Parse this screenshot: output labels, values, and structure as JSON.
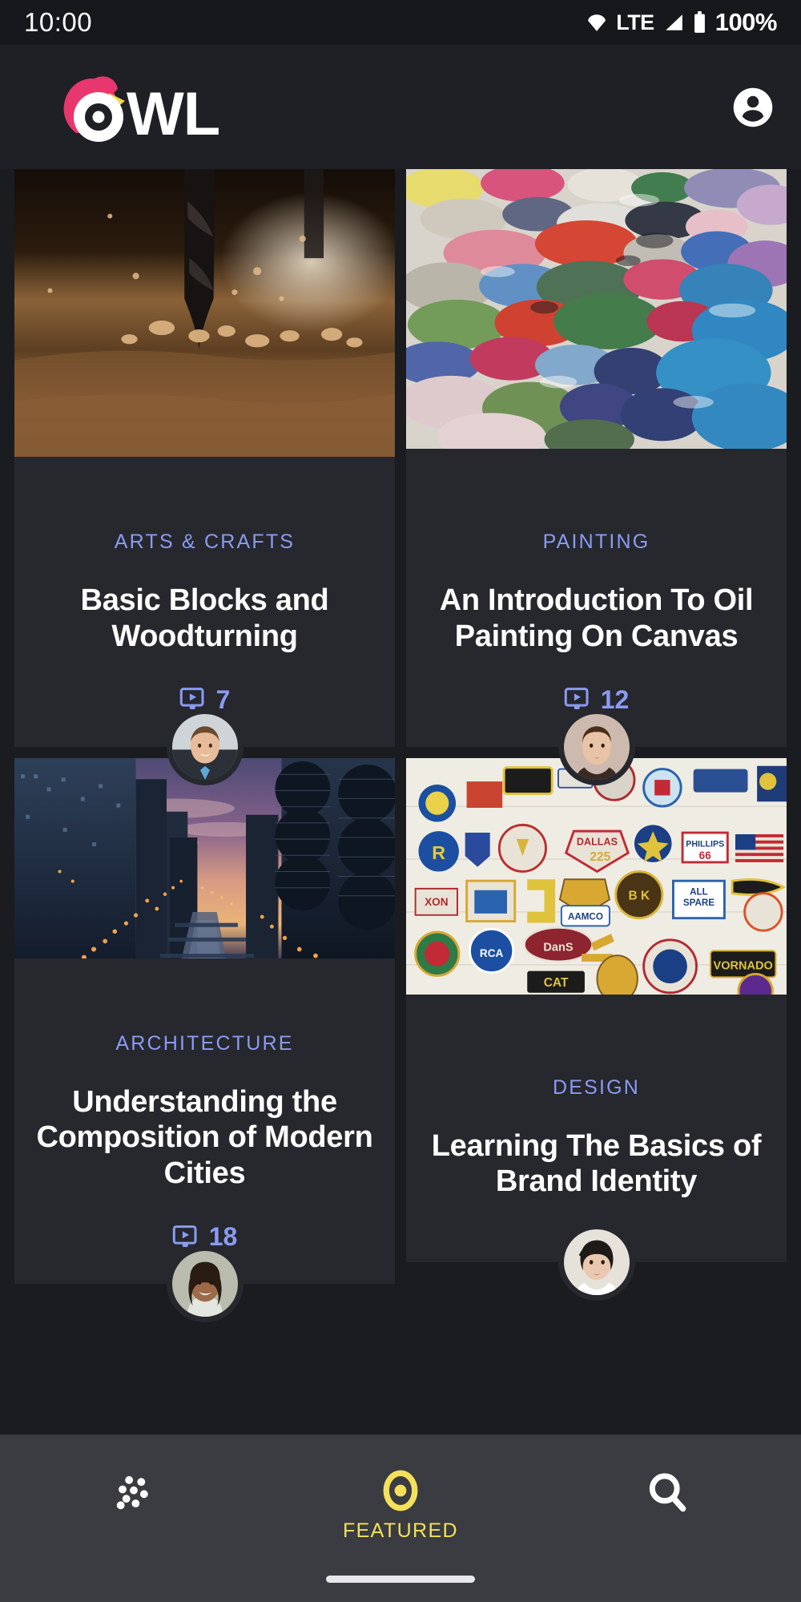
{
  "status_bar": {
    "time": "10:00",
    "network_label": "LTE",
    "battery_percent": "100%",
    "icons": [
      "wifi-icon",
      "signal-icon",
      "battery-icon"
    ]
  },
  "header": {
    "brand": "OWL",
    "brand_colors": {
      "mark_pink": "#e8366e",
      "beak_yellow": "#f5d84e",
      "wordmark": "#ffffff"
    },
    "account_icon": "account-circle-icon"
  },
  "theme": {
    "page_bg": "#1a1c20",
    "card_bg": "#26282e",
    "accent_blue": "#8b9bf2",
    "accent_yellow": "#f5e05c",
    "nav_bg": "#3a3c42"
  },
  "cards": [
    {
      "category": "ARTS & CRAFTS",
      "title": "Basic Blocks and Woodturning",
      "video_count": "7",
      "video_icon": "video-monitor-icon",
      "image_alt": "drill-bit-boring-into-wood",
      "avatar_alt": "author-avatar"
    },
    {
      "category": "PAINTING",
      "title": "An Introduction To Oil Painting On Canvas",
      "video_count": "12",
      "video_icon": "video-monitor-icon",
      "image_alt": "colorful-oil-paint-palette",
      "avatar_alt": "author-avatar"
    },
    {
      "category": "ARCHITECTURE",
      "title": "Understanding the Composition of Modern Cities",
      "video_count": "18",
      "video_icon": "video-monitor-icon",
      "image_alt": "city-skyline-river-at-dusk",
      "avatar_alt": "author-avatar"
    },
    {
      "category": "DESIGN",
      "title": "Learning The Basics of Brand Identity",
      "video_count": "",
      "video_icon": "video-monitor-icon",
      "image_alt": "wall-of-embroidered-patches",
      "avatar_alt": "author-avatar"
    }
  ],
  "bottom_nav": {
    "items": [
      {
        "icon": "dots-grid-icon",
        "label": "",
        "active": false
      },
      {
        "icon": "owl-eye-icon",
        "label": "FEATURED",
        "active": true
      },
      {
        "icon": "search-icon",
        "label": "",
        "active": false
      }
    ]
  }
}
